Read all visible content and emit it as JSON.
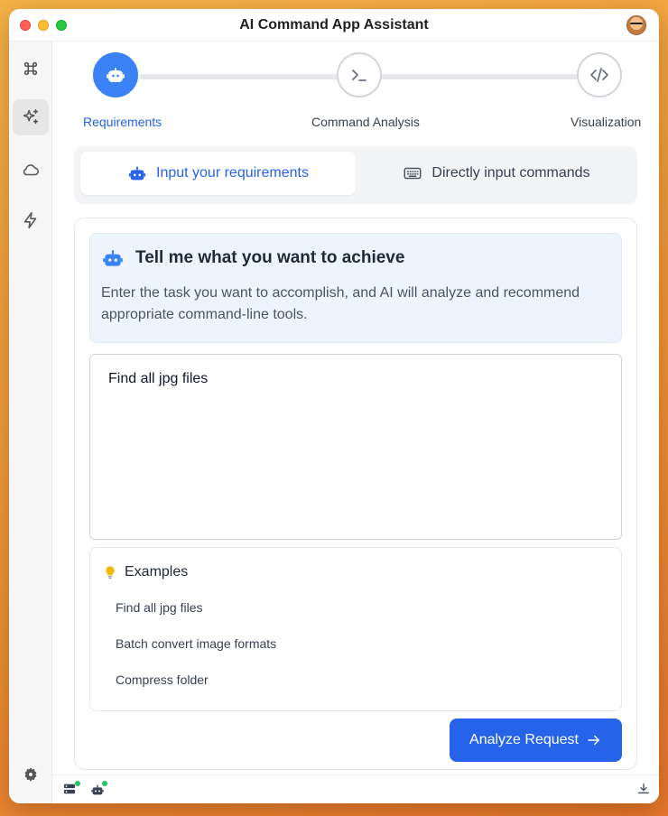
{
  "window": {
    "title": "AI Command App Assistant"
  },
  "sidebar": {
    "items": [
      {
        "icon": "command-icon"
      },
      {
        "icon": "sparkles-icon",
        "active": true
      },
      {
        "icon": "cloud-icon"
      },
      {
        "icon": "lightning-icon"
      }
    ],
    "bottom_icon": "gear-icon"
  },
  "stepper": {
    "steps": [
      {
        "label": "Requirements",
        "icon": "robot-icon",
        "active": true
      },
      {
        "label": "Command Analysis",
        "icon": "terminal-icon",
        "active": false
      },
      {
        "label": "Visualization",
        "icon": "code-icon",
        "active": false
      }
    ]
  },
  "mode_tabs": {
    "requirements": "Input your requirements",
    "commands": "Directly input commands",
    "active": "requirements"
  },
  "hint": {
    "title": "Tell me what you want to achieve",
    "text": "Enter the task you want to accomplish, and AI will analyze and recommend appropriate command-line tools."
  },
  "input": {
    "value": "Find all jpg files"
  },
  "examples": {
    "title": "Examples",
    "items": [
      "Find all jpg files",
      "Batch convert image formats",
      "Compress folder"
    ]
  },
  "action": {
    "analyze_label": "Analyze Request"
  },
  "colors": {
    "accent": "#2563eb",
    "step_active": "#3b82f6",
    "hint_bg": "#eef4fe",
    "status_dot": "#22c55e"
  }
}
